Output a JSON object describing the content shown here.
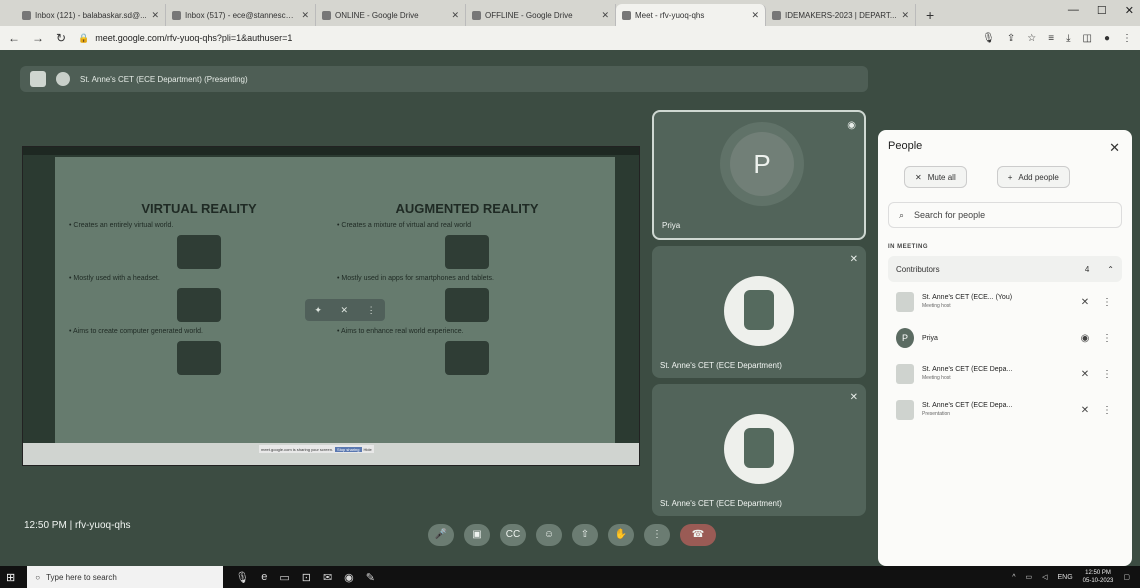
{
  "browser": {
    "tabs": [
      {
        "label": "Inbox (121) - balabaskar.sd@..."
      },
      {
        "label": "Inbox (517) - ece@stannescet..."
      },
      {
        "label": "ONLINE - Google Drive"
      },
      {
        "label": "OFFLINE - Google Drive"
      },
      {
        "label": "Meet - rfv-yuoq-qhs"
      },
      {
        "label": "IDEMAKERS-2023 | DEPART..."
      }
    ],
    "url": "meet.google.com/rfv-yuoq-qhs?pli=1&authuser=1"
  },
  "meet": {
    "presenting_label": "St. Anne's CET (ECE Department) (Presenting)",
    "meeting_time": "12:50 PM",
    "meeting_code": "rfv-yuoq-qhs",
    "participant_badge": "4",
    "tiles": [
      {
        "name": "Priya",
        "avatar": "P"
      },
      {
        "name": "St. Anne's CET (ECE Department)"
      },
      {
        "name": "St. Anne's CET (ECE Department)"
      }
    ]
  },
  "slide": {
    "left_title": "VIRTUAL REALITY",
    "right_title": "AUGMENTED REALITY",
    "left_bullets": [
      "Creates an entirely virtual world.",
      "Mostly used with a headset.",
      "Aims to create computer generated world."
    ],
    "right_bullets": [
      "Creates a mixture of virtual and real world",
      "Mostly used in apps for smartphones and tablets.",
      "Aims to enhance real world experience."
    ],
    "notice_text": "meet.google.com is sharing your screen.",
    "notice_stop": "Stop sharing",
    "notice_hide": "Hide"
  },
  "people_panel": {
    "title": "People",
    "mute_all": "Mute all",
    "add_people": "Add people",
    "search_placeholder": "Search for people",
    "in_meeting": "IN MEETING",
    "contributors_label": "Contributors",
    "contributors_count": "4",
    "people": [
      {
        "name": "St. Anne's CET (ECE... (You)",
        "role": "Meeting host",
        "icon": "mic-off"
      },
      {
        "name": "Priya",
        "role": "",
        "avatar": "P",
        "icon": "speaking"
      },
      {
        "name": "St. Anne's CET (ECE Depa...",
        "role": "Meeting host",
        "icon": "mic-off"
      },
      {
        "name": "St. Anne's CET (ECE Depa...",
        "role": "Presentation",
        "icon": "audio-off"
      }
    ]
  },
  "taskbar": {
    "search_placeholder": "Type here to search",
    "lang": "ENG",
    "time": "12:50 PM",
    "date": "05-10-2023"
  }
}
